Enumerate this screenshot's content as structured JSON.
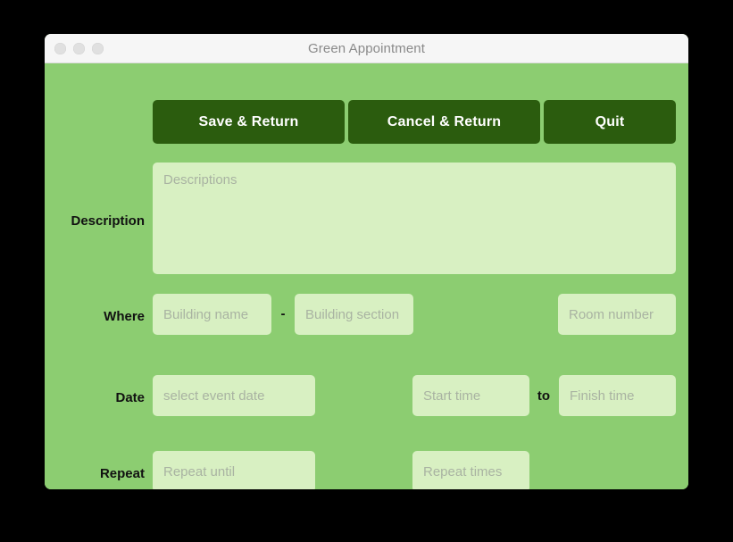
{
  "window": {
    "title": "Green Appointment",
    "traffic_lights": [
      "close",
      "minimize",
      "maximize"
    ]
  },
  "colors": {
    "window_background": "#8ccd71",
    "button_green": "#2b5c0e",
    "field_fill": "#d8f0c2",
    "titlebar": "#f6f6f6",
    "desktop": "#000000",
    "label_text": "#111111",
    "placeholder_text": "#a9b3a2"
  },
  "toolbar": {
    "save_label": "Save & Return",
    "cancel_label": "Cancel & Return",
    "quit_label": "Quit"
  },
  "form": {
    "description": {
      "label": "Description",
      "placeholder": "Descriptions",
      "value": ""
    },
    "where": {
      "label": "Where",
      "building_name_placeholder": "Building name",
      "building_name_value": "",
      "separator": "-",
      "building_section_placeholder": "Building section",
      "building_section_value": "",
      "room_number_placeholder": "Room number",
      "room_number_value": ""
    },
    "date": {
      "label": "Date",
      "event_date_placeholder": "select event date",
      "event_date_value": "",
      "calendar_icon": "calendar-icon",
      "start_time_placeholder": "Start time",
      "start_time_value": "",
      "to_separator": "to",
      "finish_time_placeholder": "Finish time",
      "finish_time_value": ""
    },
    "repeat": {
      "label": "Repeat",
      "repeat_until_placeholder": "Repeat until",
      "repeat_until_value": "",
      "calendar_icon": "calendar-icon",
      "repeat_times_placeholder": "Repeat times",
      "repeat_times_value": ""
    }
  }
}
